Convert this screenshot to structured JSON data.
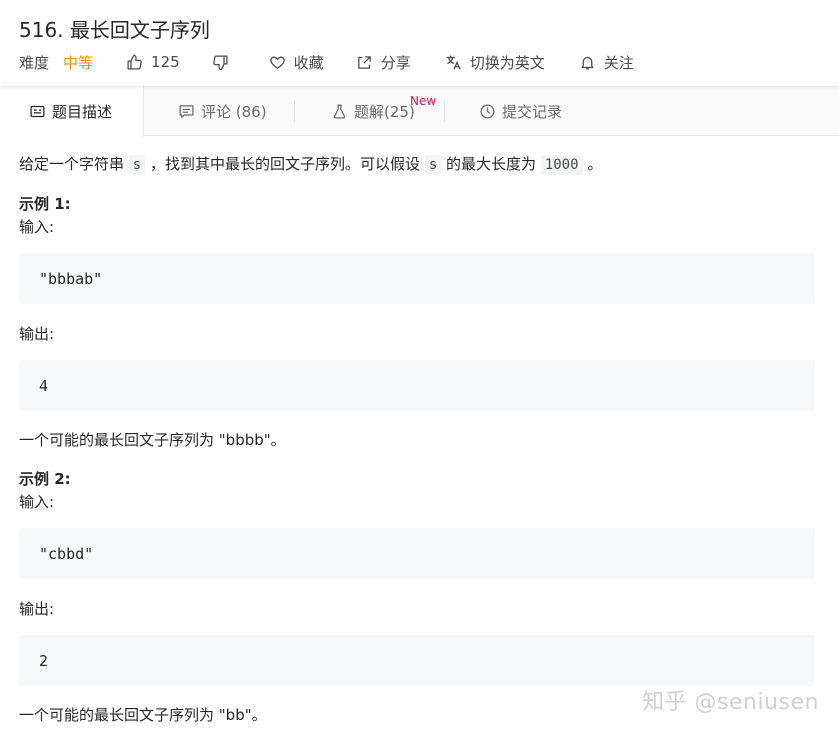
{
  "header": {
    "title": "516. 最长回文子序列",
    "difficulty_label": "难度",
    "difficulty_value": "中等",
    "likes": "125",
    "favorite_label": "收藏",
    "share_label": "分享",
    "switch_lang_label": "切换为英文",
    "follow_label": "关注"
  },
  "tabs": [
    {
      "label": "题目描述",
      "icon": "description-icon"
    },
    {
      "label": "评论 (86)",
      "icon": "comment-icon"
    },
    {
      "label": "题解(25)",
      "icon": "flask-icon",
      "badge": "New"
    },
    {
      "label": "提交记录",
      "icon": "clock-icon"
    }
  ],
  "problem": {
    "desc_part1": "给定一个字符串",
    "desc_code1": "s",
    "desc_part2": "，找到其中最长的回文子序列。可以假设",
    "desc_code2": "s",
    "desc_part3": "的最大长度为",
    "desc_code3": "1000",
    "desc_part4": "。",
    "examples": [
      {
        "title": "示例 1:",
        "input_label": "输入:",
        "input": "\"bbbab\"",
        "output_label": "输出:",
        "output": "4",
        "explanation": "一个可能的最长回文子序列为 \"bbbb\"。"
      },
      {
        "title": "示例 2:",
        "input_label": "输入:",
        "input": "\"cbbd\"",
        "output_label": "输出:",
        "output": "2",
        "explanation": "一个可能的最长回文子序列为 \"bb\"。"
      }
    ]
  },
  "watermark": "知乎 @seniusen",
  "colors": {
    "difficulty_medium": "#ef8d15",
    "new_badge": "#d6146a",
    "code_bg": "#f7f8fa"
  }
}
